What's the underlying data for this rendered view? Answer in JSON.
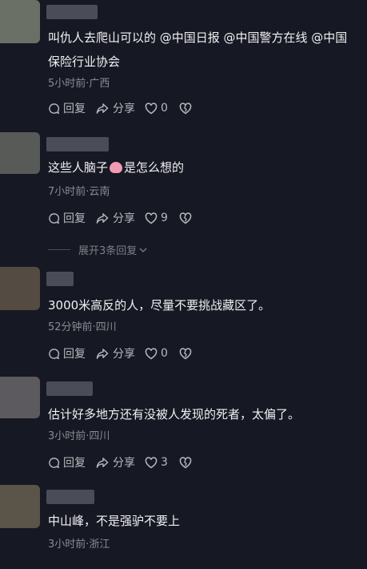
{
  "colors": {
    "background": "#161823",
    "text": "#f1f1f3",
    "meta": "#8a8b91",
    "action": "#b9babf"
  },
  "comments": [
    {
      "text_line1": "叫仇人去爬山可以的 @中国日报 @中国警方在线 @中国",
      "text_line2": "保险行业协会",
      "meta": "5小时前·广西",
      "reply": "回复",
      "share": "分享",
      "likes": "0"
    },
    {
      "text_before": "这些人脑子",
      "text_emoji": "brain-emoji",
      "text_after": "是怎么想的",
      "meta": "7小时前·云南",
      "reply": "回复",
      "share": "分享",
      "likes": "9",
      "expand": "展开3条回复"
    },
    {
      "text": "3000米高反的人，尽量不要挑战藏区了。",
      "meta": "52分钟前·四川",
      "reply": "回复",
      "share": "分享",
      "likes": "0"
    },
    {
      "text": "估计好多地方还有没被人发现的死者，太偏了。",
      "meta": "3小时前·四川",
      "reply": "回复",
      "share": "分享",
      "likes": "3"
    },
    {
      "text": "中山峰，不是强驴不要上",
      "meta": "3小时前·浙江"
    }
  ]
}
